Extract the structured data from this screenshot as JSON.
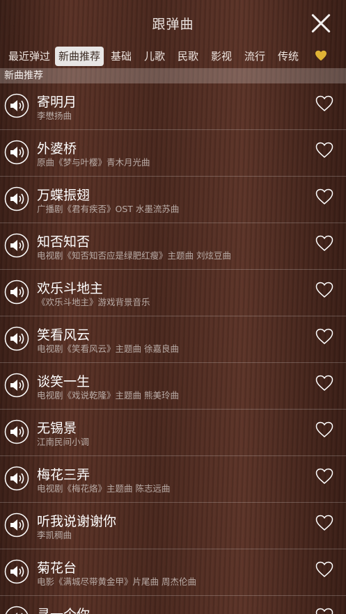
{
  "header": {
    "title": "跟弹曲"
  },
  "tabs": [
    {
      "label": "最近弹过"
    },
    {
      "label": "新曲推荐"
    },
    {
      "label": "基础"
    },
    {
      "label": "儿歌"
    },
    {
      "label": "民歌"
    },
    {
      "label": "影视"
    },
    {
      "label": "流行"
    },
    {
      "label": "传统"
    }
  ],
  "favorites_tab_icon": "heart-icon",
  "section_title": "新曲推荐",
  "songs": [
    {
      "name": "寄明月",
      "sub": "李懋扬曲"
    },
    {
      "name": "外婆桥",
      "sub": "原曲《梦与叶樱》青木月光曲"
    },
    {
      "name": "万蝶振翅",
      "sub": "广播剧《君有疾否》OST 水墨流苏曲"
    },
    {
      "name": "知否知否",
      "sub": "电视剧《知否知否应是绿肥红瘦》主题曲 刘炫豆曲"
    },
    {
      "name": "欢乐斗地主",
      "sub": "《欢乐斗地主》游戏背景音乐"
    },
    {
      "name": "笑看风云",
      "sub": "电视剧《笑看风云》主题曲 徐嘉良曲"
    },
    {
      "name": "谈笑一生",
      "sub": "电视剧《戏说乾隆》主题曲 熊美玲曲"
    },
    {
      "name": "无锡景",
      "sub": "江南民间小调"
    },
    {
      "name": "梅花三弄",
      "sub": "电视剧《梅花烙》主题曲 陈志远曲"
    },
    {
      "name": "听我说谢谢你",
      "sub": "李凯稠曲"
    },
    {
      "name": "菊花台",
      "sub": "电影《满城尽带黄金甲》片尾曲 周杰伦曲"
    },
    {
      "name": "寻一个你",
      "sub": ""
    }
  ],
  "colors": {
    "accent_gold": "#e0b335",
    "active_tab_bg": "#e8e6e5"
  }
}
